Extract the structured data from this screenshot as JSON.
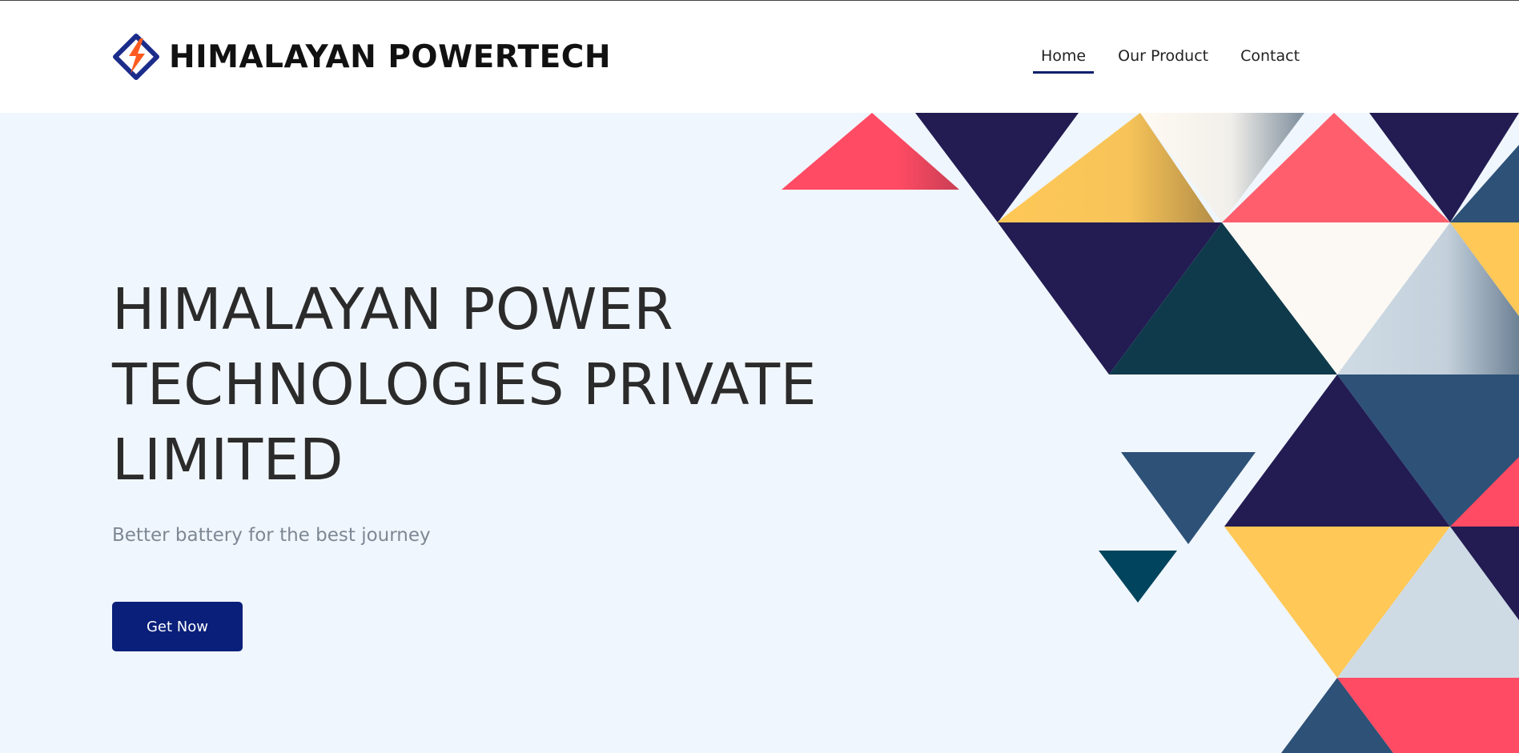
{
  "header": {
    "brand_name": "HIMALAYAN POWERTECH",
    "logo_icon": "lightning-diamond-icon",
    "nav": [
      {
        "label": "Home",
        "active": true
      },
      {
        "label": "Our Product",
        "active": false
      },
      {
        "label": "Contact",
        "active": false
      }
    ]
  },
  "hero": {
    "title_lines": [
      "HIMALAYAN POWER",
      "TECHNOLOGIES PRIVATE",
      "LIMITED"
    ],
    "subtitle": "Better battery for the best journey",
    "cta_label": "Get Now"
  },
  "colors": {
    "brand_navy": "#0a1f7a",
    "logo_orange": "#ff5a1f",
    "hero_bg": "#f0f6fd",
    "shape_red": "#ff4b63",
    "shape_yellow": "#ffc857",
    "shape_navy": "#221c52",
    "shape_blue": "#2d5177",
    "shape_teal": "#0f3a4b",
    "shape_light": "#cfdbe4"
  }
}
